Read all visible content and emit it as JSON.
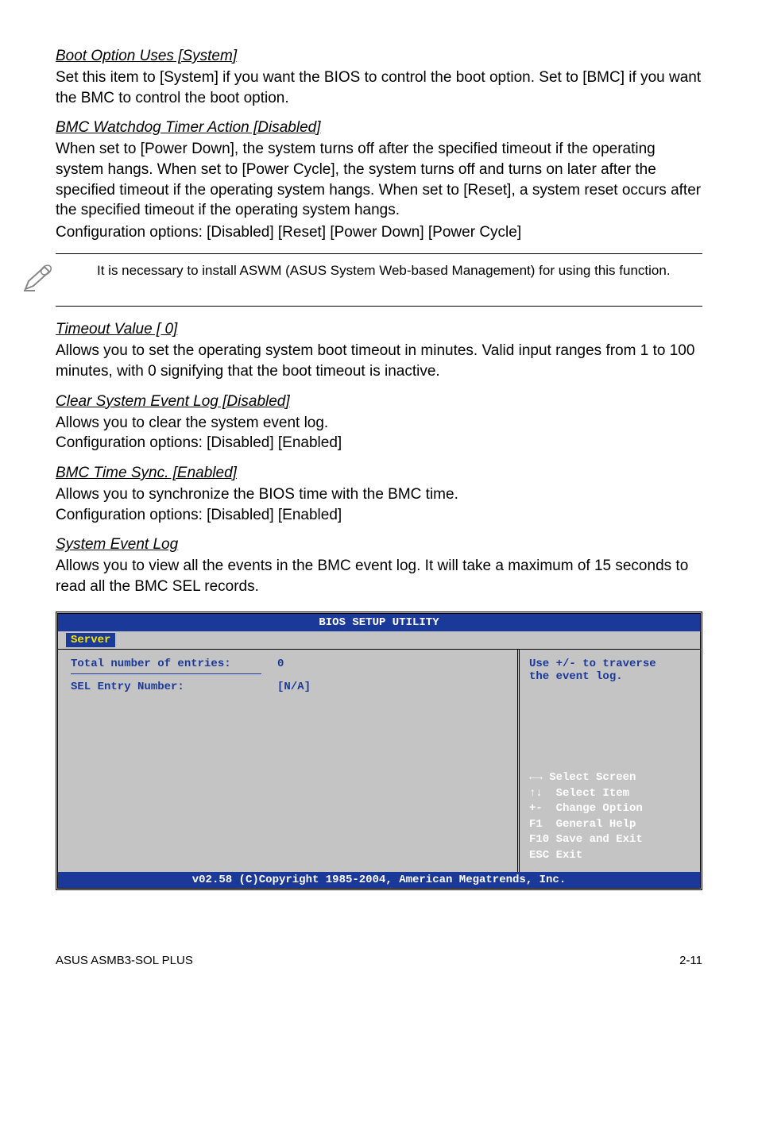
{
  "sections": {
    "boot_option": {
      "title": "Boot Option Uses [System]",
      "text": "Set this item to [System] if you want the BIOS to control the boot option. Set to [BMC] if you want the BMC to control the boot option."
    },
    "bmc_watchdog": {
      "title": "BMC Watchdog Timer Action [Disabled]",
      "text": "When set to [Power Down], the system turns off after the specified timeout if the operating system hangs. When set to [Power Cycle], the system turns off and turns on later after the specified timeout if the operating system hangs. When set to [Reset], a system reset occurs after the specified timeout if the operating system hangs.",
      "config": "Configuration options: [Disabled] [Reset] [Power Down] [Power Cycle]"
    },
    "note": {
      "text": "It is necessary to install ASWM (ASUS System Web-based Management) for using this function."
    },
    "timeout_value": {
      "title": "Timeout Value [  0]",
      "text": "Allows you to set the operating system boot timeout in minutes. Valid input ranges from 1 to 100 minutes, with 0 signifying that the boot timeout is inactive."
    },
    "clear_log": {
      "title": "Clear System Event Log [Disabled]",
      "text1": "Allows you to clear the system event log.",
      "text2": "Configuration options: [Disabled] [Enabled]"
    },
    "bmc_time": {
      "title": "BMC Time Sync. [Enabled]",
      "text1": "Allows you to synchronize the BIOS time with the BMC time.",
      "text2": "Configuration options: [Disabled] [Enabled]"
    },
    "system_event_log": {
      "title": "System Event Log",
      "text": "Allows you to view all the events in the BMC event log. It will take a maximum of 15 seconds to read all the BMC SEL records."
    }
  },
  "bios": {
    "header": "BIOS SETUP UTILITY",
    "tab": "Server",
    "left": {
      "row1_label": "Total number of entries:",
      "row1_value": "0",
      "row2_label": "SEL Entry Number:",
      "row2_value": "[N/A]"
    },
    "right_top1": "Use +/- to traverse",
    "right_top2": "the event log.",
    "nav": {
      "l1": "←→ Select Screen",
      "l2": "↑↓  Select Item",
      "l3": "+-  Change Option",
      "l4": "F1  General Help",
      "l5": "F10 Save and Exit",
      "l6": "ESC Exit"
    },
    "footer": "v02.58 (C)Copyright 1985-2004, American Megatrends, Inc."
  },
  "page_footer": {
    "left": "ASUS ASMB3-SOL PLUS",
    "right": "2-11"
  }
}
